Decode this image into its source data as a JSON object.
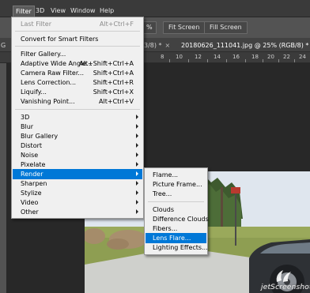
{
  "menubar": {
    "items": [
      "Filter",
      "3D",
      "View",
      "Window",
      "Help"
    ],
    "active": "Filter"
  },
  "options_bar": {
    "zoom_fragment": "%",
    "fit_screen": "Fit Screen",
    "fill_screen": "Fill Screen"
  },
  "tabs": {
    "first": "G",
    "second": "3/8) *",
    "second_close": "×",
    "third": "20180626_111041.jpg @ 25% (RGB/8) *",
    "third_close": "×"
  },
  "ruler": {
    "labels": [
      "8",
      "10",
      "12",
      "14",
      "16",
      "18",
      "20",
      "22",
      "24"
    ]
  },
  "filter_menu": {
    "last_filter": {
      "label": "Last Filter",
      "shortcut": "Alt+Ctrl+F"
    },
    "convert": {
      "label": "Convert for Smart Filters"
    },
    "filter_gallery": {
      "label": "Filter Gallery..."
    },
    "adaptive_wide_angle": {
      "label": "Adaptive Wide Angle...",
      "shortcut": "Alt+Shift+Ctrl+A"
    },
    "camera_raw": {
      "label": "Camera Raw Filter...",
      "shortcut": "Shift+Ctrl+A"
    },
    "lens_correction": {
      "label": "Lens Correction...",
      "shortcut": "Shift+Ctrl+R"
    },
    "liquify": {
      "label": "Liquify...",
      "shortcut": "Shift+Ctrl+X"
    },
    "vanishing_point": {
      "label": "Vanishing Point...",
      "shortcut": "Alt+Ctrl+V"
    },
    "submenus": [
      "3D",
      "Blur",
      "Blur Gallery",
      "Distort",
      "Noise",
      "Pixelate",
      "Render",
      "Sharpen",
      "Stylize",
      "Video",
      "Other"
    ],
    "highlighted": "Render"
  },
  "render_submenu": {
    "items": [
      "Flame...",
      "Picture Frame...",
      "Tree...",
      "Clouds",
      "Difference Clouds",
      "Fibers...",
      "Lens Flare...",
      "Lighting Effects..."
    ],
    "highlighted": "Lens Flare..."
  },
  "watermark": {
    "text": "jetScreenshot"
  },
  "colors": {
    "menu_highlight": "#0078d7",
    "menubar_bg": "#3a3a3a",
    "options_bar_bg": "#535353",
    "workspace_bg": "#282828",
    "menu_bg": "#f0f0f0"
  }
}
